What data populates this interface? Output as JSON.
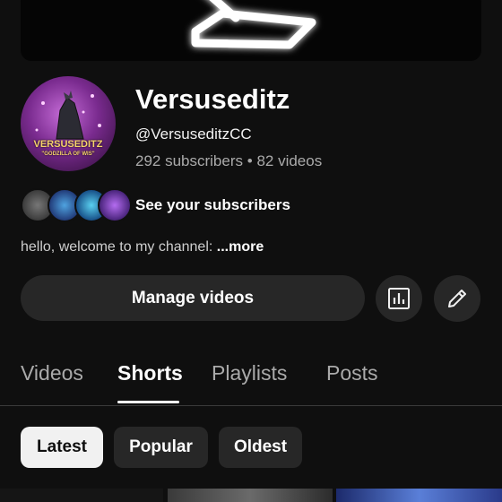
{
  "channel": {
    "name": "Versuseditz",
    "handle": "@VersuseditzCC",
    "subscribers": "292 subscribers",
    "separator": "•",
    "videos": "82 videos",
    "avatar_text_main": "VERSUSEDITZ",
    "avatar_text_sub": "\"GODZILLA OF WIS\""
  },
  "subscribers_link": {
    "label": "See your subscribers"
  },
  "description": {
    "text": "hello, welcome to my channel: ",
    "more": "...more"
  },
  "actions": {
    "manage_label": "Manage videos",
    "analytics_icon": "analytics-icon",
    "edit_icon": "pencil-icon"
  },
  "tabs": [
    {
      "label": "Videos",
      "active": false
    },
    {
      "label": "Shorts",
      "active": true
    },
    {
      "label": "Playlists",
      "active": false
    },
    {
      "label": "Posts",
      "active": false
    }
  ],
  "chips": [
    {
      "label": "Latest",
      "selected": true
    },
    {
      "label": "Popular",
      "selected": false
    },
    {
      "label": "Oldest",
      "selected": false
    }
  ],
  "colors": {
    "background": "#0f0f0f",
    "button": "#272727",
    "secondary_text": "#aaaaaa",
    "chip_selected": "#f1f1f1"
  }
}
